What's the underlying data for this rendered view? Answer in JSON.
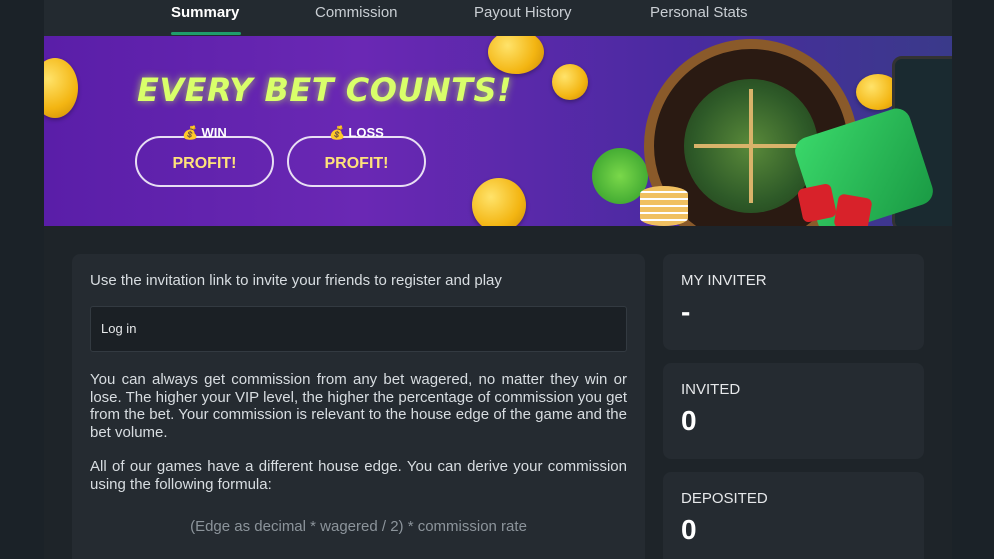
{
  "tabs": [
    {
      "label": "Summary",
      "active": true
    },
    {
      "label": "Commission",
      "active": false
    },
    {
      "label": "Payout History",
      "active": false
    },
    {
      "label": "Personal Stats",
      "active": false
    }
  ],
  "banner": {
    "title": "EVERY BET COUNTS!",
    "win": {
      "label": "WIN",
      "value": "PROFIT!",
      "icon": "money-bag-clover-icon"
    },
    "loss": {
      "label": "LOSS",
      "value": "PROFIT!",
      "icon": "money-bag-hat-icon"
    }
  },
  "invite": {
    "instruction": "Use the invitation link to invite your friends to register and play",
    "link_box": "Log in",
    "paragraph1": "You can always get commission from any bet wagered, no matter they win or lose. The higher your VIP level, the higher the percentage of commission you get from the bet. Your commission is relevant to the house edge of the game and the bet volume.",
    "paragraph2": "All of our games have a different house edge. You can derive your commission using the following formula:",
    "formula": "(Edge as decimal * wagered / 2) * commission rate"
  },
  "stats": [
    {
      "label": "MY INVITER",
      "value": "-"
    },
    {
      "label": "INVITED",
      "value": "0"
    },
    {
      "label": "DEPOSITED",
      "value": "0"
    }
  ],
  "colors": {
    "accent": "#1f9d6b",
    "banner_title": "#d9ff6a",
    "profit": "#ffe27a",
    "background": "#1b2228",
    "card": "#252b31"
  }
}
